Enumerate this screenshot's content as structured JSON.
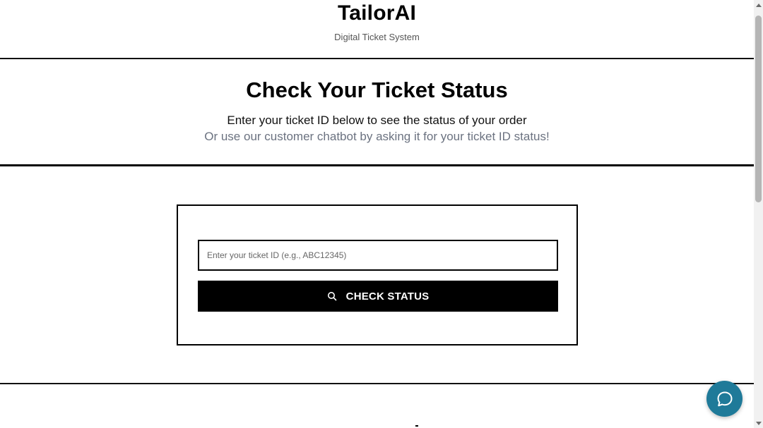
{
  "header": {
    "brand": "TailorAI",
    "tagline": "Digital Ticket System"
  },
  "hero": {
    "title": "Check Your Ticket Status",
    "subtitle": "Enter your ticket ID below to see the status of your order",
    "secondary": "Or use our customer chatbot by asking it for your ticket ID status!"
  },
  "form": {
    "ticket_input": {
      "value": "",
      "placeholder": "Enter your ticket ID (e.g., ABC12345)"
    },
    "submit_label": "CHECK STATUS",
    "submit_icon": "search-icon"
  },
  "chat": {
    "icon": "chat-bubble-icon"
  },
  "colors": {
    "primary": "#000000",
    "chat_accent": "#1f7a99",
    "muted_text": "#6b7280",
    "background": "#ffffff"
  }
}
